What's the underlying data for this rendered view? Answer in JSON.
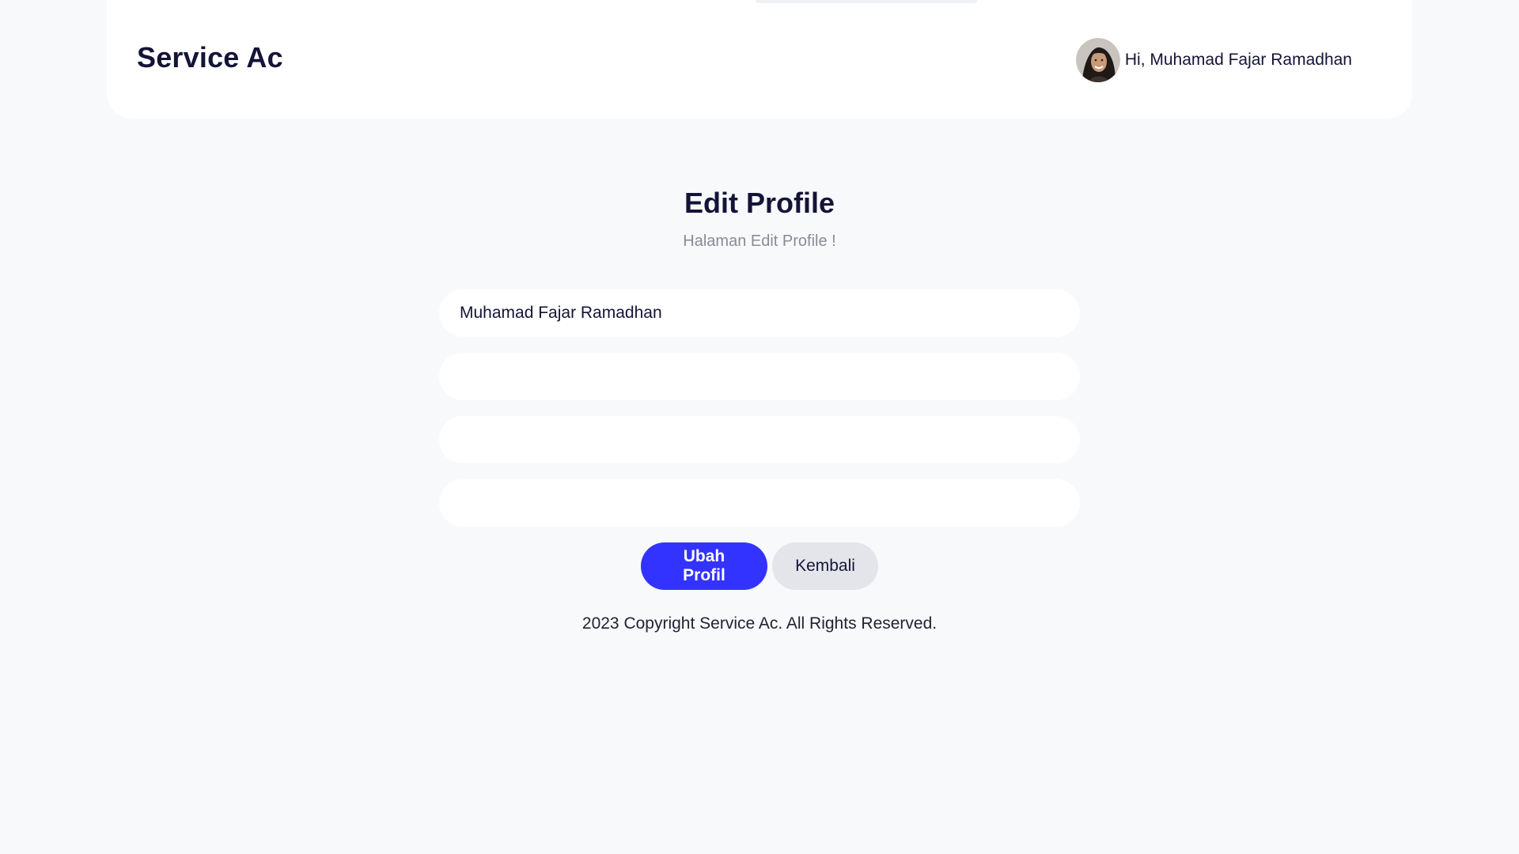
{
  "header": {
    "brand": "Service Ac",
    "greeting": "Hi, Muhamad Fajar Ramadhan",
    "avatar_icon": "user-avatar-photo"
  },
  "main": {
    "title": "Edit Profile",
    "subtitle": "Halaman Edit Profile !",
    "fields": [
      {
        "value": "Muhamad Fajar Ramadhan",
        "placeholder": ""
      },
      {
        "value": "",
        "placeholder": ""
      },
      {
        "value": "",
        "placeholder": ""
      },
      {
        "value": "",
        "placeholder": ""
      }
    ],
    "actions": {
      "submit_label": "Ubah Profil",
      "back_label": "Kembali"
    }
  },
  "footer": {
    "text": "2023 Copyright Service Ac. All Rights Reserved."
  },
  "colors": {
    "primary": "#3333ff",
    "background": "#f8f9fb",
    "card": "#ffffff",
    "text": "#141438",
    "muted": "#8a8a96",
    "secondary_button": "#e4e5ea"
  }
}
